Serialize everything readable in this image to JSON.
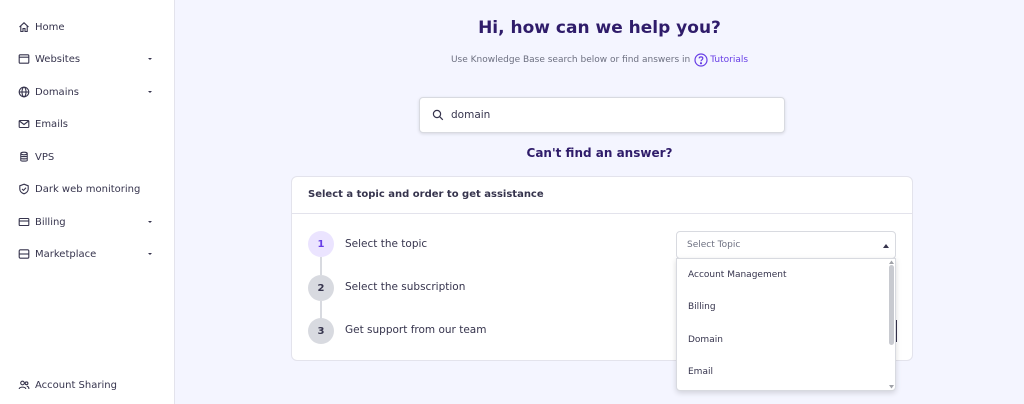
{
  "sidebar": {
    "items": [
      {
        "label": "Home",
        "icon": "home-icon",
        "has_chevron": false
      },
      {
        "label": "Websites",
        "icon": "window-icon",
        "has_chevron": true
      },
      {
        "label": "Domains",
        "icon": "globe-icon",
        "has_chevron": true
      },
      {
        "label": "Emails",
        "icon": "mail-icon",
        "has_chevron": false
      },
      {
        "label": "VPS",
        "icon": "database-icon",
        "has_chevron": false
      },
      {
        "label": "Dark web monitoring",
        "icon": "shield-icon",
        "has_chevron": false
      },
      {
        "label": "Billing",
        "icon": "billing-icon",
        "has_chevron": true
      },
      {
        "label": "Marketplace",
        "icon": "marketplace-icon",
        "has_chevron": true
      }
    ],
    "footer": {
      "label": "Account Sharing",
      "icon": "users-icon"
    }
  },
  "main": {
    "title": "Hi, how can we help you?",
    "subtitle": "Use Knowledge Base search below or find answers in",
    "tutorials_label": "Tutorials",
    "search": {
      "value": "domain",
      "placeholder": ""
    },
    "cant_find": "Can't find an answer?",
    "card": {
      "header": "Select a topic and order to get assistance",
      "steps": [
        {
          "number": "1",
          "label": "Select the topic",
          "active": true
        },
        {
          "number": "2",
          "label": "Select the subscription",
          "active": false
        },
        {
          "number": "3",
          "label": "Get support from our team",
          "active": false
        }
      ],
      "topic_select": {
        "placeholder": "Select Topic",
        "options": [
          "Account Management",
          "Billing",
          "Domain",
          "Email"
        ]
      }
    }
  },
  "colors": {
    "accent": "#673de6",
    "title": "#2f1c6a",
    "background": "#f4f5ff",
    "text": "#36344d",
    "muted": "#6d7081"
  }
}
